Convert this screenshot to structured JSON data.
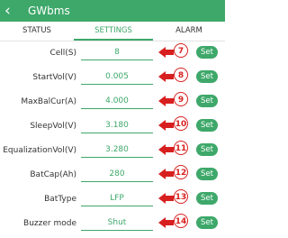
{
  "app": {
    "title": "GWbms",
    "back_icon": "‹"
  },
  "tabs": [
    {
      "label": "STATUS"
    },
    {
      "label": "SETTINGS"
    },
    {
      "label": "ALARM"
    }
  ],
  "rows": [
    {
      "label": "Cell(S)",
      "value": "8",
      "badge": "7",
      "set": "Set"
    },
    {
      "label": "StartVol(V)",
      "value": "0.005",
      "badge": "8",
      "set": "Set"
    },
    {
      "label": "MaxBalCur(A)",
      "value": "4.000",
      "badge": "9",
      "set": "Set"
    },
    {
      "label": "SleepVol(V)",
      "value": "3.180",
      "badge": "10",
      "set": "Set"
    },
    {
      "label": "EqualizationVol(V)",
      "value": "3.280",
      "badge": "11",
      "set": "Set"
    },
    {
      "label": "BatCap(Ah)",
      "value": "280",
      "badge": "12",
      "set": "Set"
    },
    {
      "label": "BatType",
      "value": "LFP",
      "badge": "13",
      "set": "Set"
    },
    {
      "label": "Buzzer mode",
      "value": "Shut",
      "badge": "14",
      "set": "Set"
    }
  ],
  "colors": {
    "accent": "#3ea86a",
    "annotation": "#d81f1f"
  }
}
